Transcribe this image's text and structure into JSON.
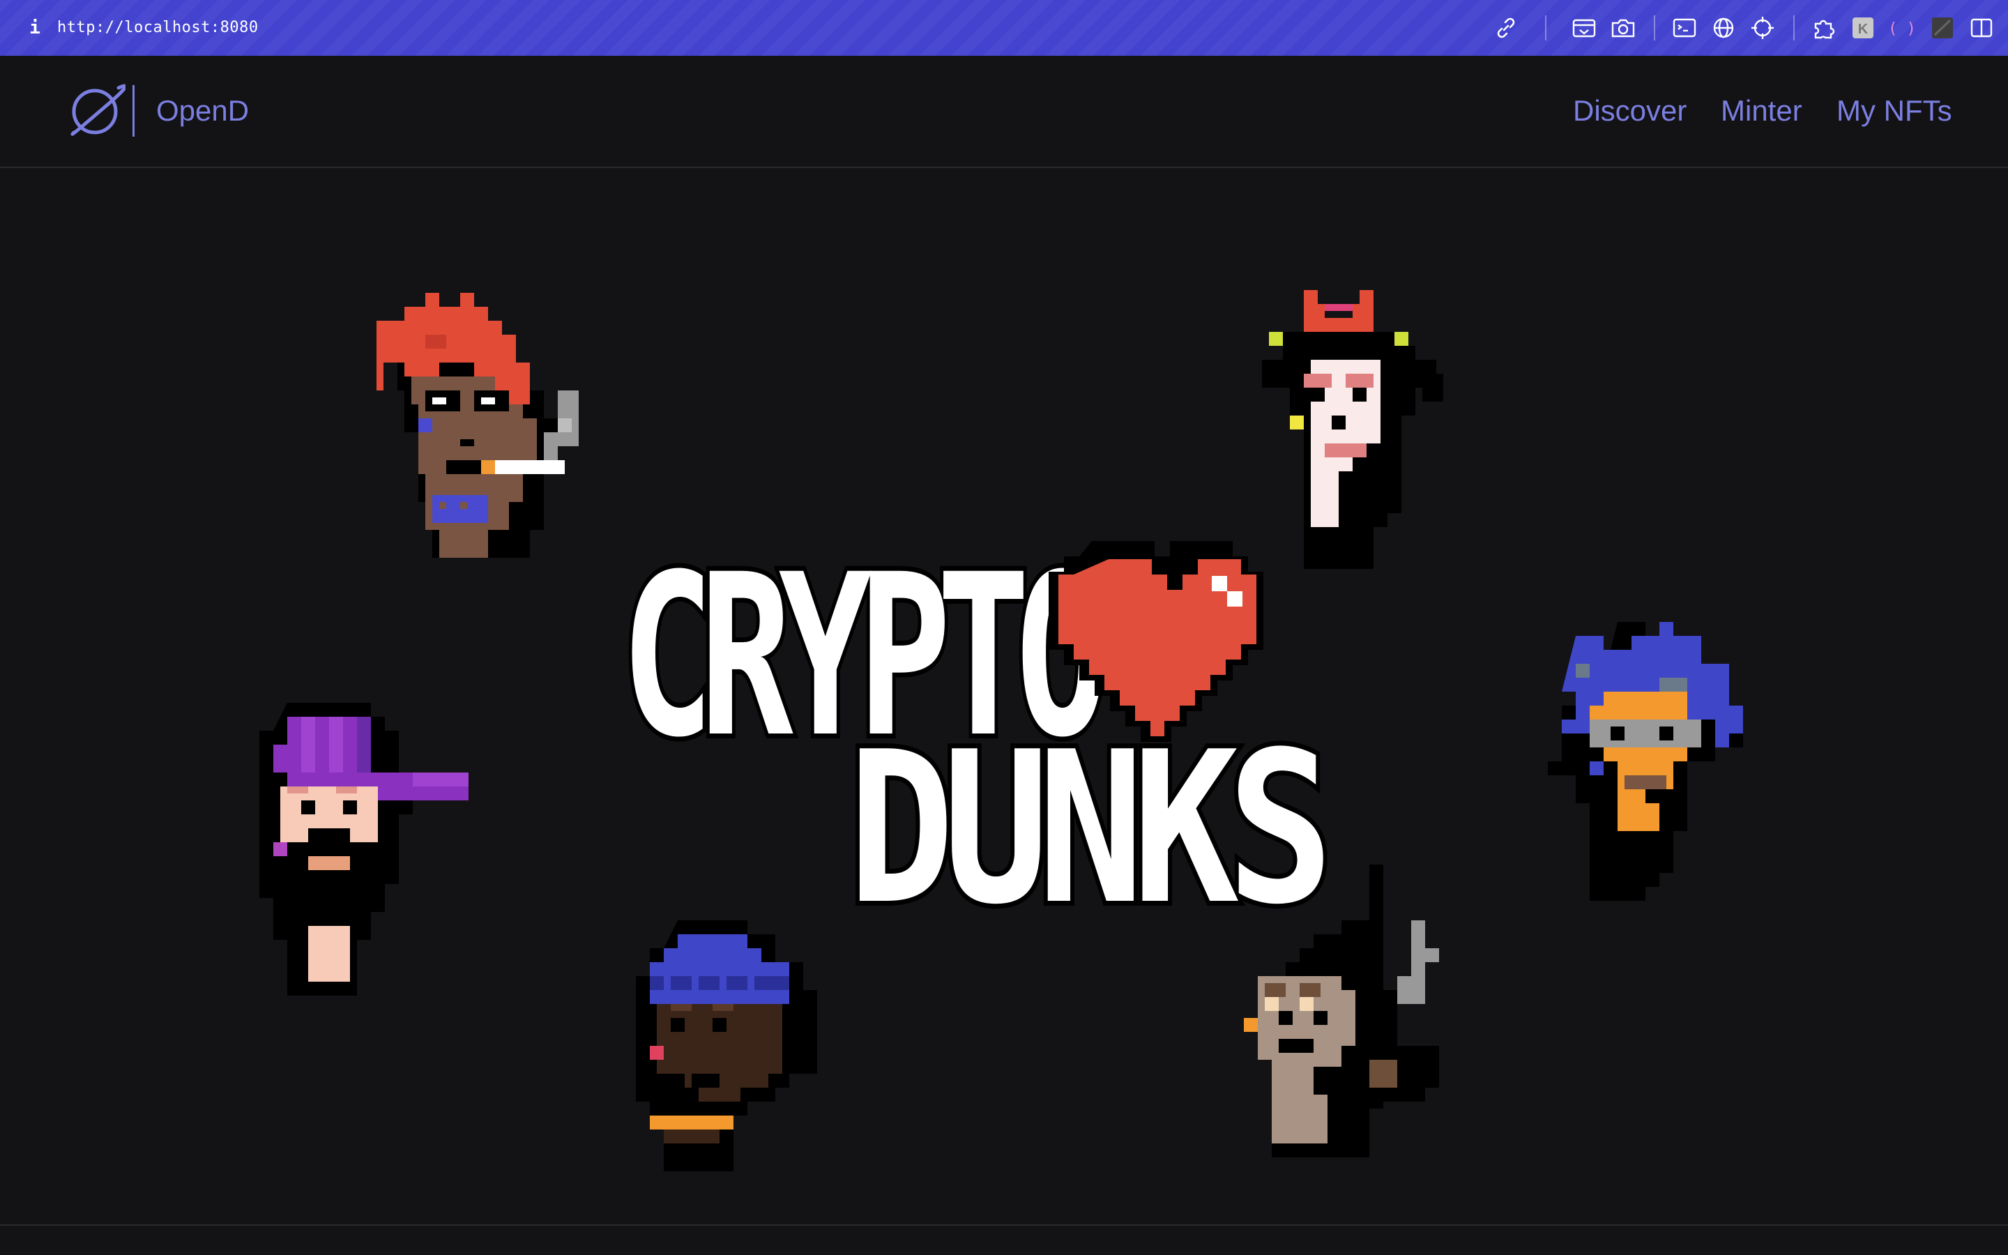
{
  "browser": {
    "url": "http://localhost:8080",
    "info_icon": "i",
    "toolbar_icons": [
      "link-icon",
      "screenshot-icon",
      "camera-icon",
      "terminal-icon",
      "globe-icon",
      "crosshair-icon",
      "extensions-icon",
      "extension-k-icon",
      "extension-bracket-icon",
      "extension-square-icon",
      "sidebar-icon"
    ]
  },
  "header": {
    "brand": "OpenD",
    "nav": [
      "Discover",
      "Minter",
      "My NFTs"
    ]
  },
  "hero": {
    "logo_text_line1": "CRYPTO",
    "logo_text_line2": "DUNKS",
    "heart_color": "#e14f3c",
    "punks": [
      "punk-red-hair",
      "punk-devil-horns",
      "punk-purple-cap",
      "punk-blue-hair",
      "punk-blue-beanie",
      "punk-mohawk-pipe"
    ]
  },
  "colors": {
    "browser_bar": "#4343d0",
    "background": "#131215",
    "accent": "#7b7fe0"
  }
}
